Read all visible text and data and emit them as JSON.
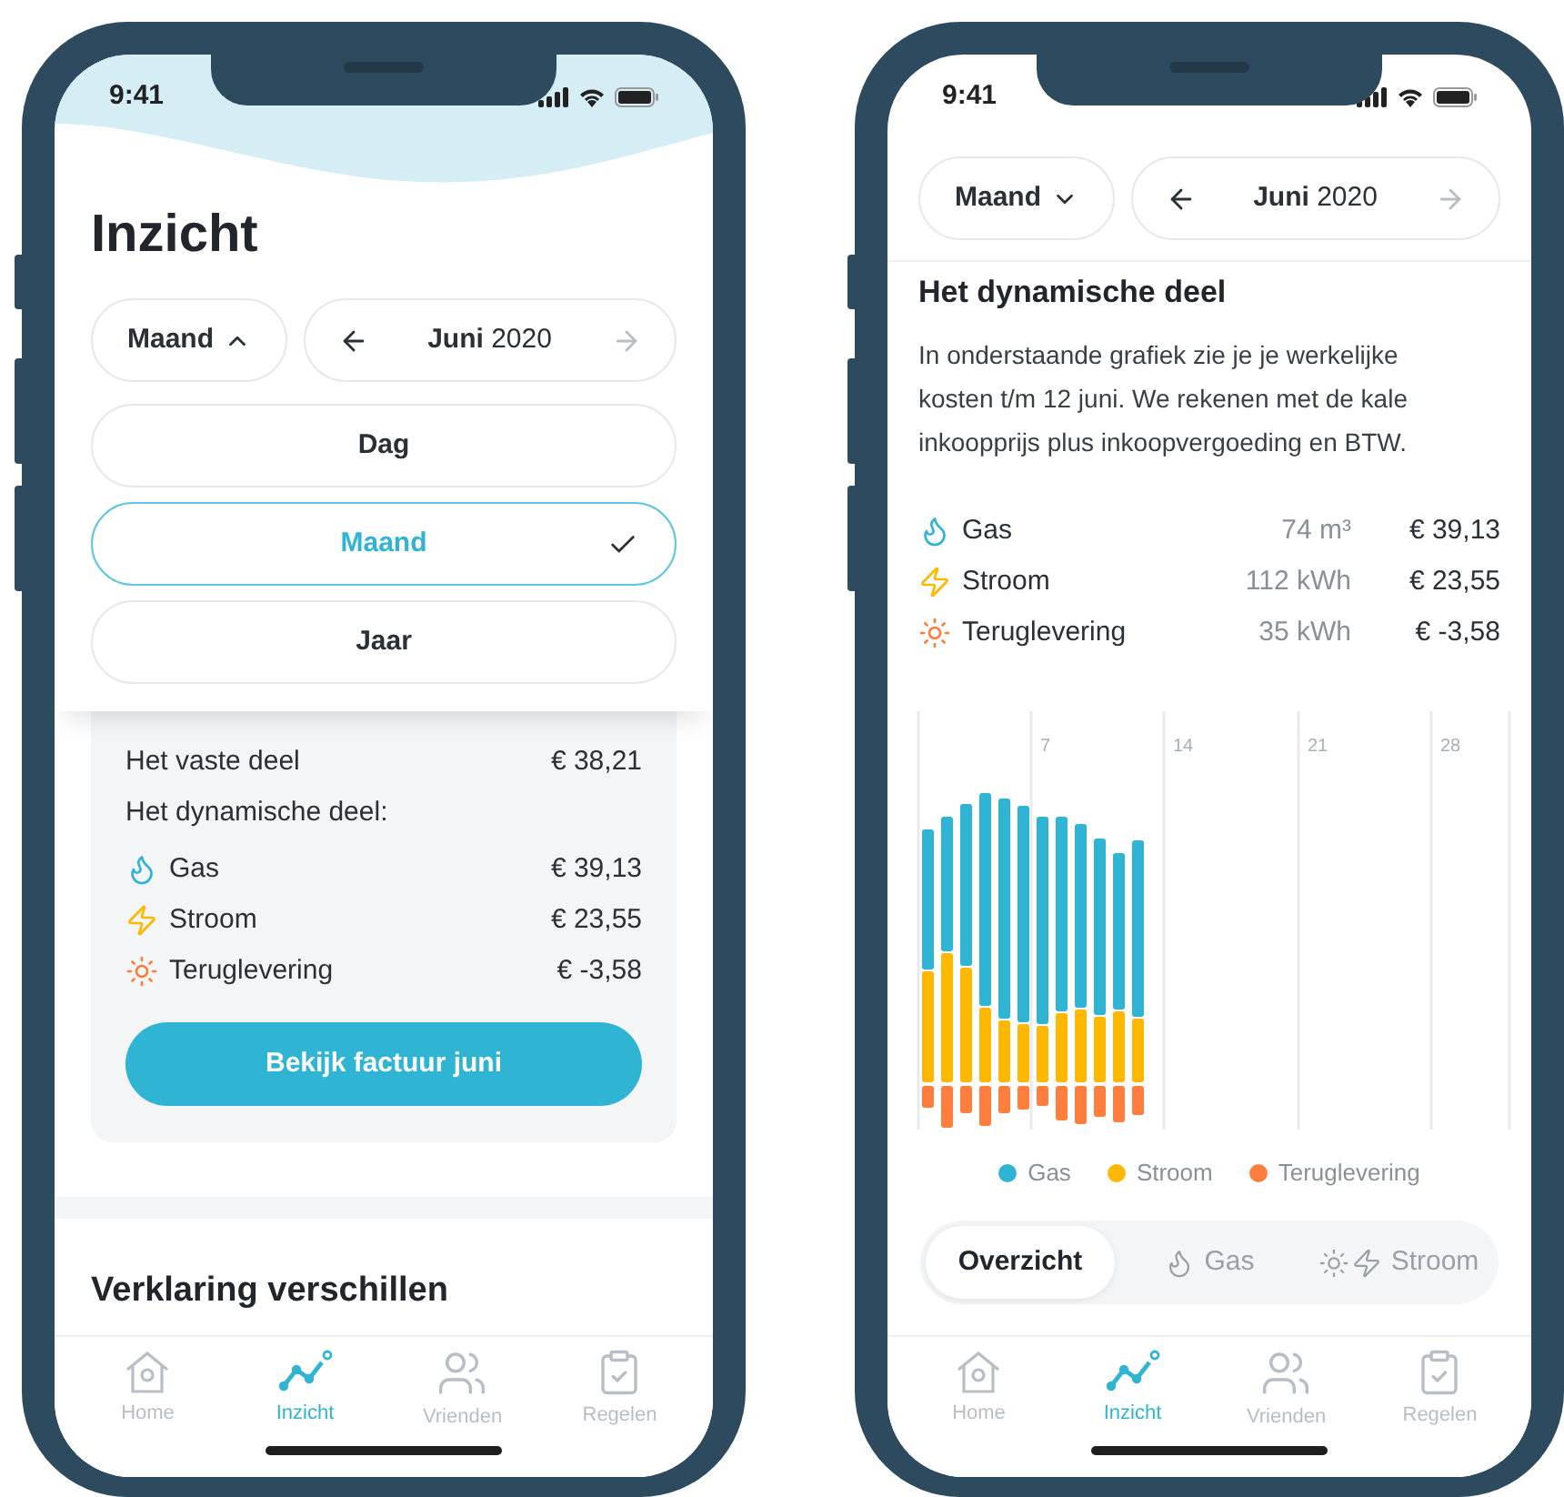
{
  "phones": [
    {
      "kind": "overview",
      "status_time": "9:41",
      "title": "Inzicht",
      "period_select": {
        "label": "Maand",
        "expanded": true
      },
      "date_nav": {
        "month": "Juni",
        "year": "2020",
        "next_disabled": true
      },
      "period_options": [
        {
          "label": "Dag",
          "selected": false
        },
        {
          "label": "Maand",
          "selected": true
        },
        {
          "label": "Jaar",
          "selected": false
        }
      ],
      "summary": {
        "fixed_label": "Het vaste deel",
        "fixed_amount": "€ 38,21",
        "dynamic_label": "Het dynamische deel:",
        "items": [
          {
            "kind": "gas",
            "label": "Gas",
            "amount": "€ 39,13"
          },
          {
            "kind": "power",
            "label": "Stroom",
            "amount": "€ 23,55"
          },
          {
            "kind": "return",
            "label": "Teruglevering",
            "amount": "€ -3,58"
          }
        ],
        "button": "Bekijk factuur juni"
      },
      "next_heading": "Verklaring verschillen",
      "tab_bar": [
        {
          "kind": "home",
          "label": "Home",
          "selected": false
        },
        {
          "kind": "insight",
          "label": "Inzicht",
          "selected": true
        },
        {
          "kind": "friends",
          "label": "Vrienden",
          "selected": false
        },
        {
          "kind": "rules",
          "label": "Regelen",
          "selected": false
        }
      ]
    },
    {
      "kind": "detail",
      "status_time": "9:41",
      "period_select": {
        "label": "Maand",
        "expanded": false
      },
      "date_nav": {
        "month": "Juni",
        "year": "2020",
        "next_disabled": true
      },
      "heading": "Het dynamische deel",
      "intro": "In onderstaande grafiek zie je je werkelijke kosten t/m 12 juni. We rekenen met de kale inkoopprijs plus inkoopvergoeding en BTW.",
      "items": [
        {
          "kind": "gas",
          "label": "Gas",
          "usage": "74 m³",
          "amount": "€ 39,13"
        },
        {
          "kind": "power",
          "label": "Stroom",
          "usage": "112 kWh",
          "amount": "€ 23,55"
        },
        {
          "kind": "return",
          "label": "Teruglevering",
          "usage": "35 kWh",
          "amount": "€ -3,58"
        }
      ],
      "chart": {
        "day_labels": [
          "7",
          "14",
          "21",
          "28"
        ],
        "legend": [
          {
            "label": "Gas",
            "color": "#2fb5d3"
          },
          {
            "label": "Stroom",
            "color": "#ffb800"
          },
          {
            "label": "Teruglevering",
            "color": "#ff7e3e"
          }
        ]
      },
      "view_switch": [
        {
          "kind": "overview",
          "label": "Overzicht",
          "selected": true
        },
        {
          "kind": "gas",
          "label": "Gas",
          "selected": false
        },
        {
          "kind": "power",
          "label": "Stroom",
          "selected": false
        }
      ],
      "tab_bar": [
        {
          "kind": "home",
          "label": "Home",
          "selected": false
        },
        {
          "kind": "insight",
          "label": "Inzicht",
          "selected": true
        },
        {
          "kind": "friends",
          "label": "Vrienden",
          "selected": false
        },
        {
          "kind": "rules",
          "label": "Regelen",
          "selected": false
        }
      ]
    }
  ]
}
